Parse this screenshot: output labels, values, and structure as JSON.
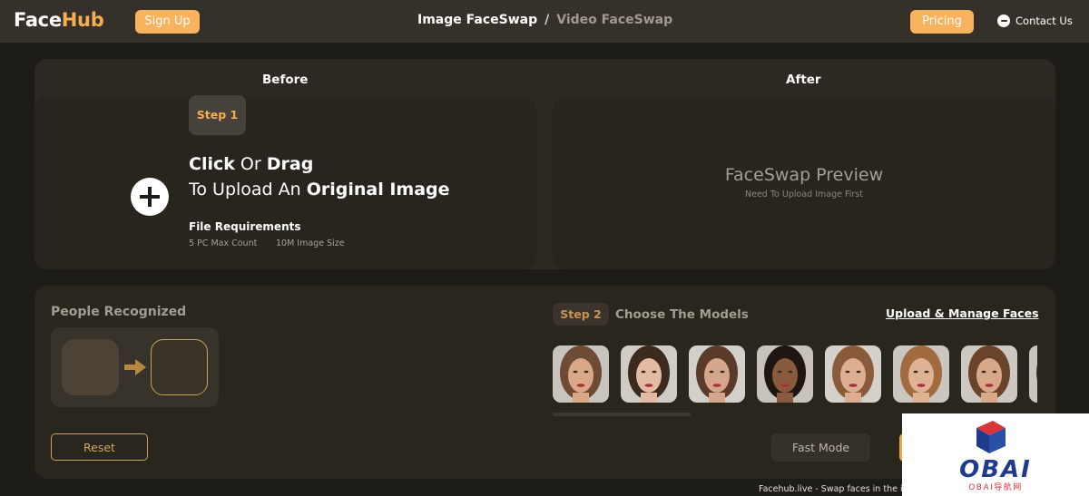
{
  "header": {
    "logo_face": "Face",
    "logo_hub": "Hub",
    "signup_label": "Sign Up",
    "nav_image": "Image FaceSwap",
    "nav_sep": "/",
    "nav_video": "Video FaceSwap",
    "pricing_label": "Pricing",
    "contact_label": "Contact Us"
  },
  "upload": {
    "before_label": "Before",
    "after_label": "After",
    "step_label": "Step 1",
    "click": "Click",
    "or": " Or ",
    "drag": "Drag",
    "to_upload": "To Upload An ",
    "original_image": "Original Image",
    "file_requirements": "File Requirements",
    "max_count": "5 PC Max Count",
    "image_size": "10M Image Size"
  },
  "preview": {
    "title": "FaceSwap Preview",
    "subtitle": "Need To Upload Image First"
  },
  "recognition": {
    "title": "People Recognized",
    "reset_label": "Reset"
  },
  "models": {
    "step_label": "Step 2",
    "title": "Choose The Models",
    "manage_label": "Upload & Manage Faces",
    "items": [
      {
        "skin": "#d9a888",
        "hair": "#6d4b34",
        "bg": "#c9c4bd"
      },
      {
        "skin": "#e2bba2",
        "hair": "#3c2a20",
        "bg": "#cfcbc5"
      },
      {
        "skin": "#d4a78d",
        "hair": "#5a3b29",
        "bg": "#d3cfca"
      },
      {
        "skin": "#8a5a3e",
        "hair": "#1f1511",
        "bg": "#c7c2bb"
      },
      {
        "skin": "#dcae92",
        "hair": "#8a5b3a",
        "bg": "#d5d0ca"
      },
      {
        "skin": "#e0b294",
        "hair": "#a26a3f",
        "bg": "#cbc6bf"
      },
      {
        "skin": "#d8a88a",
        "hair": "#6a432b",
        "bg": "#cdc8c2"
      },
      {
        "skin": "#cfa385",
        "hair": "#4f3426",
        "bg": "#c9c4bd"
      }
    ]
  },
  "footer": {
    "fast_mode_label": "Fast Mode",
    "caption": "Facehub.live - Swap faces in the image"
  },
  "colors": {
    "accent": "#f7b35d",
    "header_bg": "#36302a",
    "page_bg": "#1d1c19"
  }
}
